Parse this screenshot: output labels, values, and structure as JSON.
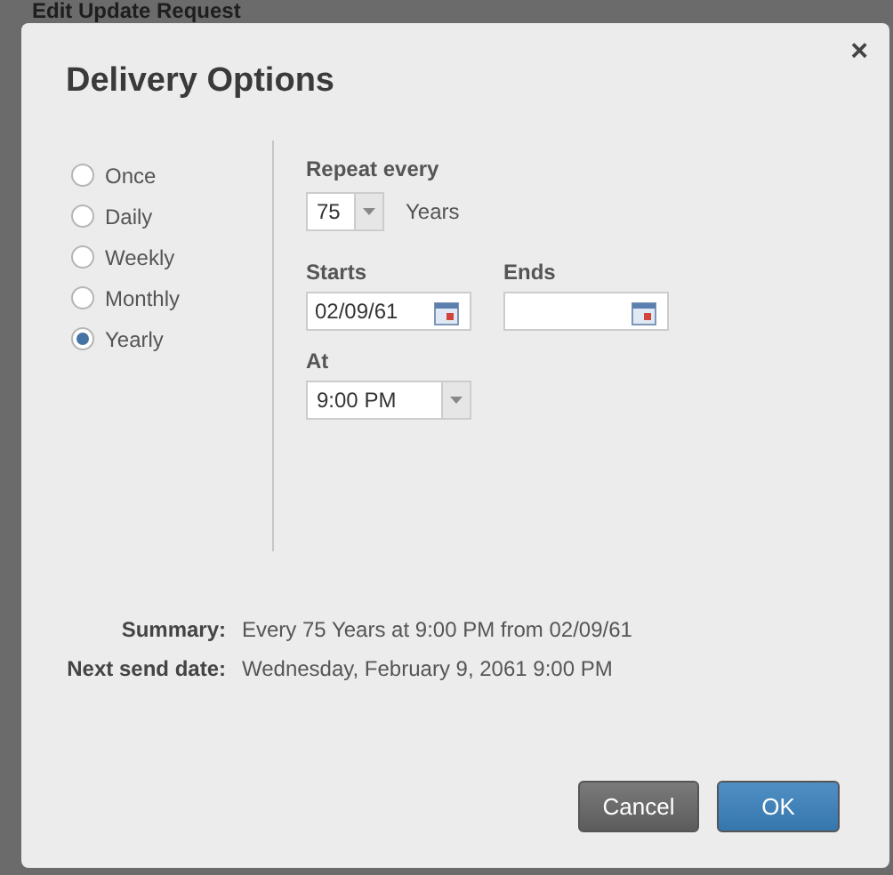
{
  "background_page": {
    "title": "Edit Update Request"
  },
  "dialog": {
    "title": "Delivery Options",
    "close": "×",
    "frequency": [
      {
        "label": "Once",
        "selected": false
      },
      {
        "label": "Daily",
        "selected": false
      },
      {
        "label": "Weekly",
        "selected": false
      },
      {
        "label": "Monthly",
        "selected": false
      },
      {
        "label": "Yearly",
        "selected": true
      }
    ],
    "repeat_every": {
      "label": "Repeat every",
      "value": "75",
      "unit": "Years"
    },
    "starts": {
      "label": "Starts",
      "value": "02/09/61"
    },
    "ends": {
      "label": "Ends"
    },
    "at": {
      "label": "At",
      "value": "9:00 PM"
    },
    "summary": [
      {
        "label": "Summary:",
        "value": "Every 75 Years at 9:00 PM from 02/09/61"
      },
      {
        "label": "Next send date:",
        "value": "Wednesday, February 9, 2061 9:00 PM"
      }
    ],
    "buttons": [
      {
        "label": "Cancel",
        "kind": "secondary"
      },
      {
        "label": "OK",
        "kind": "primary"
      }
    ]
  }
}
